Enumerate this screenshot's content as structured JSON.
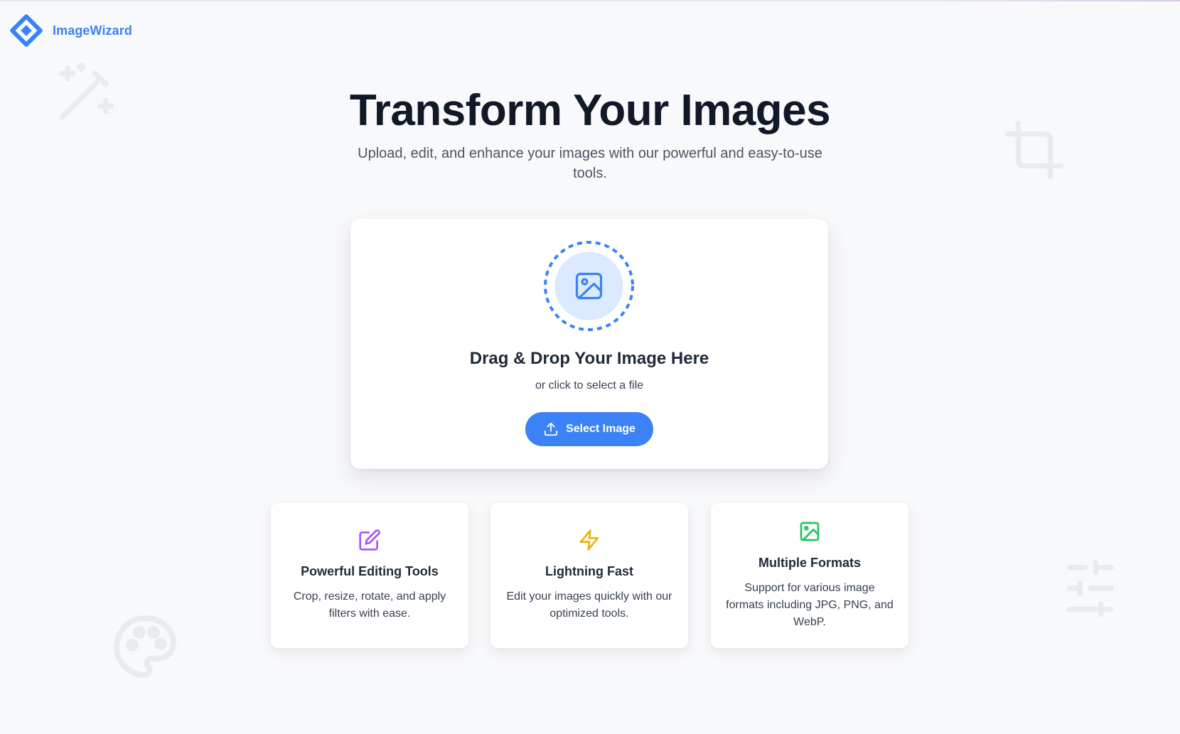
{
  "app": {
    "name": "ImageWizard",
    "brand_color": "#3b82f6"
  },
  "hero": {
    "title": "Transform Your Images",
    "subtitle": "Upload, edit, and enhance your images with our powerful and easy-to-use tools."
  },
  "upload": {
    "icon": "image-icon",
    "title": "Drag & Drop Your Image Here",
    "hint": "or click to select a file",
    "button_label": "Select Image",
    "button_icon": "upload-icon"
  },
  "features": [
    {
      "icon": "edit-icon",
      "icon_color": "#a855f7",
      "title": "Powerful Editing Tools",
      "description": "Crop, resize, rotate, and apply filters with ease."
    },
    {
      "icon": "lightning-icon",
      "icon_color": "#eab308",
      "title": "Lightning Fast",
      "description": "Edit your images quickly with our optimized tools."
    },
    {
      "icon": "image-icon",
      "icon_color": "#22c55e",
      "title": "Multiple Formats",
      "description": "Support for various image formats including JPG, PNG, and WebP."
    }
  ],
  "background_icons": [
    "magic-wand-icon",
    "crop-icon",
    "palette-icon",
    "sliders-icon"
  ]
}
